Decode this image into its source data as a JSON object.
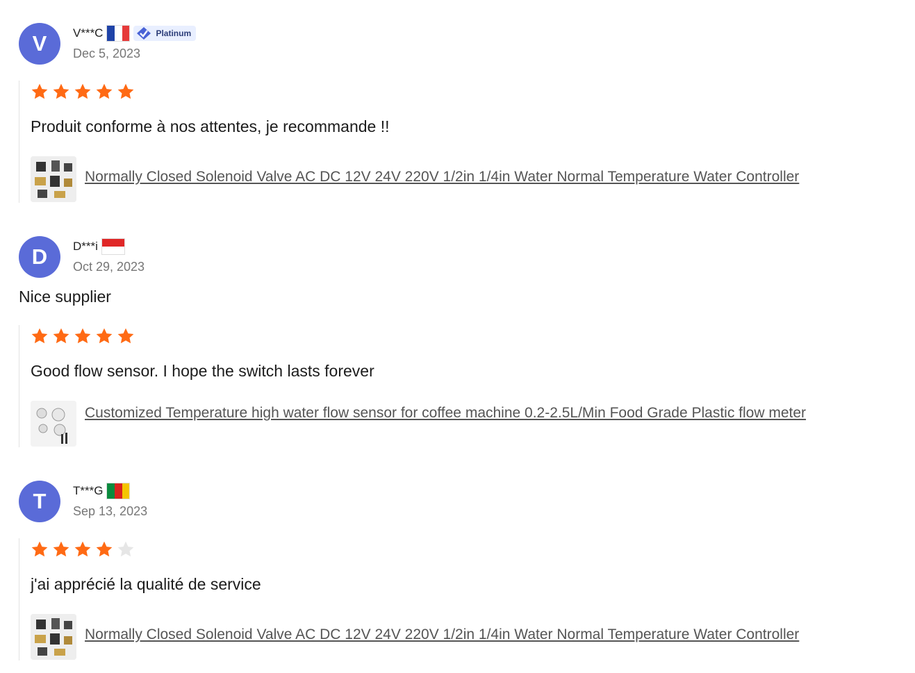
{
  "reviews": [
    {
      "initial": "V",
      "name": "V***C",
      "badge": "Platinum",
      "date": "Dec 5, 2023",
      "comment": "",
      "rating": 5,
      "text": "Produit conforme à nos attentes, je recommande !!",
      "product": "Normally Closed Solenoid Valve AC DC 12V 24V 220V 1/2in 1/4in Water Normal Temperature Water Controller"
    },
    {
      "initial": "D",
      "name": "D***i",
      "badge": "",
      "date": "Oct 29, 2023",
      "comment": "Nice supplier",
      "rating": 5,
      "text": "Good flow sensor. I hope the switch lasts forever",
      "product": "Customized Temperature high water flow sensor for coffee machine 0.2-2.5L/Min Food Grade Plastic flow meter"
    },
    {
      "initial": "T",
      "name": "T***G",
      "badge": "",
      "date": "Sep 13, 2023",
      "comment": "",
      "rating": 4,
      "text": "j'ai apprécié la qualité de service",
      "product": "Normally Closed Solenoid Valve AC DC 12V 24V 220V 1/2in 1/4in Water Normal Temperature Water Controller"
    }
  ],
  "icons": {
    "star": "star-icon",
    "verified": "verified-icon",
    "flags": [
      "flag-france-icon",
      "flag-indonesia-icon",
      "flag-cameroon-icon"
    ]
  },
  "colors": {
    "star_filled": "#ff6a14",
    "star_empty": "#e6e6e6",
    "avatar": "#5a6bd8",
    "badge_bg": "#e9efff"
  }
}
